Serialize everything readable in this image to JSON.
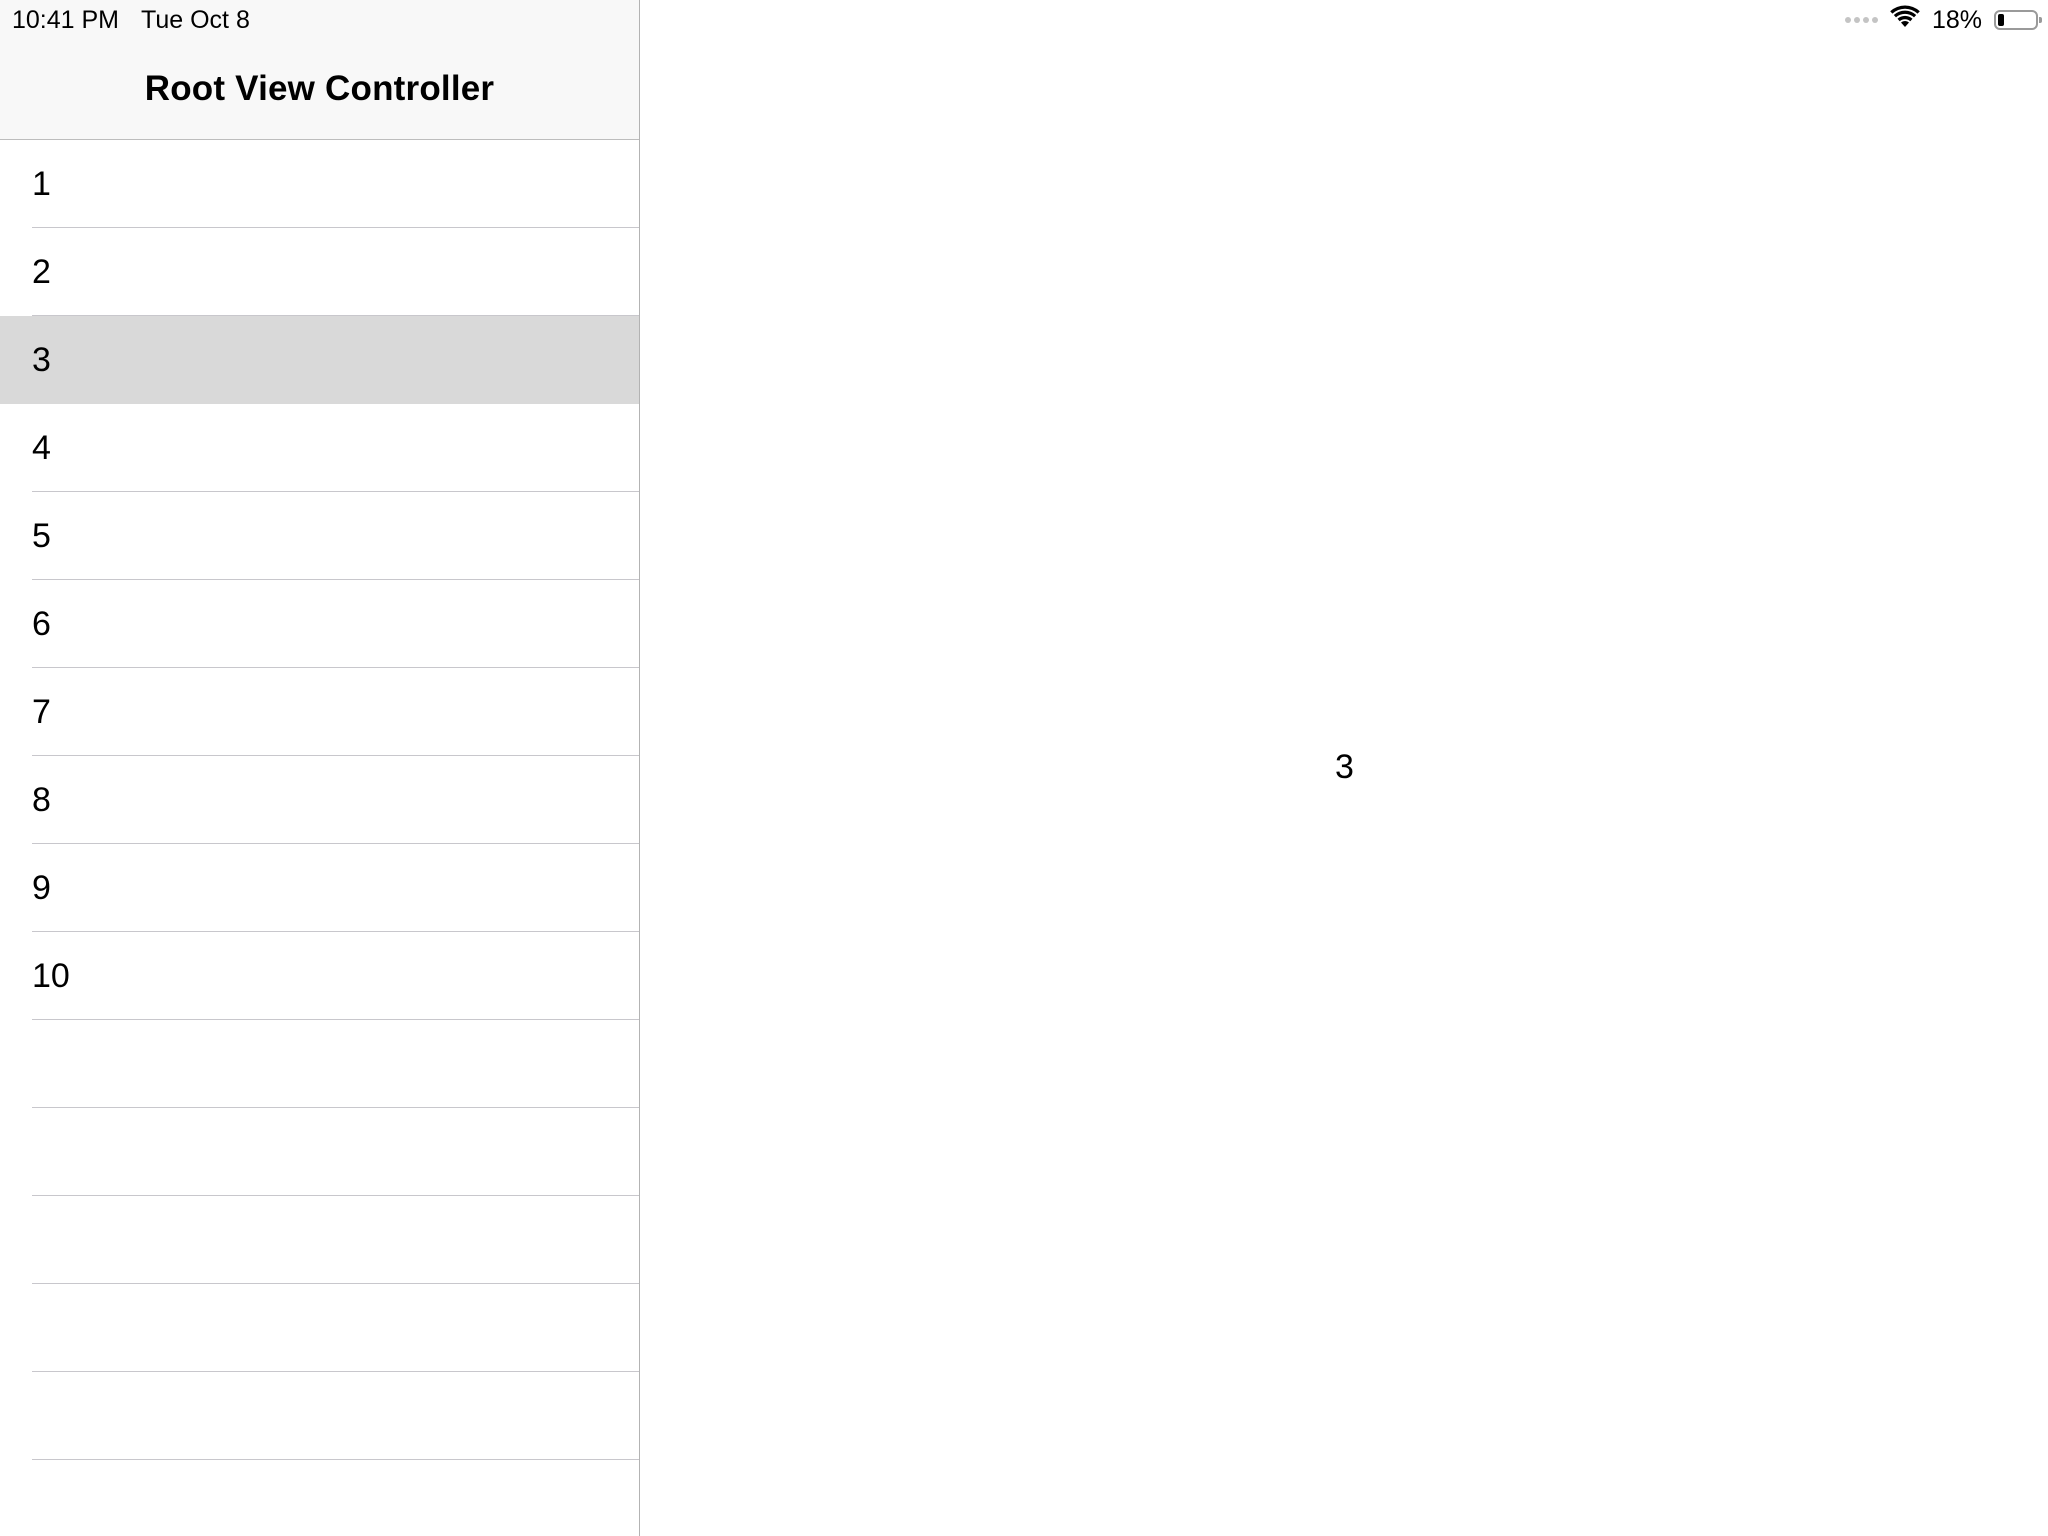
{
  "status_bar": {
    "time": "10:41 PM",
    "date": "Tue Oct 8",
    "battery_percent_label": "18%",
    "battery_level": 0.18,
    "icons": [
      "cellular-signal-icon",
      "wifi-icon",
      "battery-icon"
    ]
  },
  "master": {
    "title": "Root View Controller",
    "rows": [
      {
        "label": "1",
        "selected": false
      },
      {
        "label": "2",
        "selected": false
      },
      {
        "label": "3",
        "selected": true
      },
      {
        "label": "4",
        "selected": false
      },
      {
        "label": "5",
        "selected": false
      },
      {
        "label": "6",
        "selected": false
      },
      {
        "label": "7",
        "selected": false
      },
      {
        "label": "8",
        "selected": false
      },
      {
        "label": "9",
        "selected": false
      },
      {
        "label": "10",
        "selected": false
      },
      {
        "label": "",
        "selected": false
      },
      {
        "label": "",
        "selected": false
      },
      {
        "label": "",
        "selected": false
      },
      {
        "label": "",
        "selected": false
      },
      {
        "label": "",
        "selected": false
      },
      {
        "label": "",
        "selected": false
      }
    ]
  },
  "detail": {
    "label": "3"
  },
  "colors": {
    "selected_row": "#d9d9d9",
    "navbar_bg": "#f8f8f8",
    "separator": "#c8c7cc"
  }
}
